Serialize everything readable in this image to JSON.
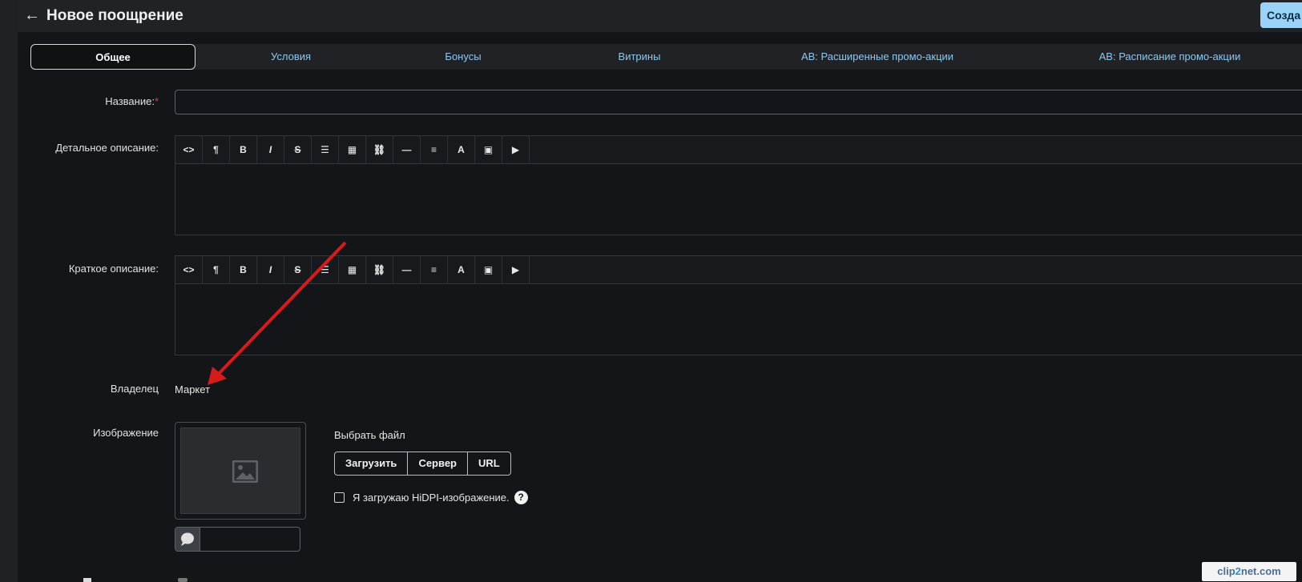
{
  "header": {
    "title": "Новое поощрение",
    "create_label": "Созда"
  },
  "tabs": [
    "Общее",
    "Условия",
    "Бонусы",
    "Витрины",
    "АВ: Расширенные промо-акции",
    "АВ: Расписание промо-акции"
  ],
  "form": {
    "name_label": "Название:",
    "required_mark": "*",
    "name_value": "",
    "detail_label": "Детальное описание:",
    "short_label": "Краткое описание:",
    "owner_label": "Владелец",
    "owner_value": "Маркет",
    "image_label": "Изображение",
    "choose_file": "Выбрать файл",
    "upload_buttons": [
      "Загрузить",
      "Сервер",
      "URL"
    ],
    "hidpi_label": "Я загружаю HiDPI-изображение.",
    "help_mark": "?"
  },
  "toolbar_icons": [
    "code-icon",
    "paragraph-icon",
    "bold-icon",
    "italic-icon",
    "strikethrough-icon",
    "list-icon",
    "table-icon",
    "link-icon",
    "horizontal-rule-icon",
    "align-icon",
    "font-color-icon",
    "image-icon",
    "video-icon"
  ],
  "toolbar_glyphs": [
    "<>",
    "¶",
    "B",
    "I",
    "S",
    "☰",
    "▦",
    "⛓",
    "—",
    "≡",
    "A",
    "▣",
    "▶"
  ],
  "annotation": {
    "arrow_color": "#d91a1a"
  },
  "watermark": {
    "left": "clip",
    "mid": "2",
    "right": "net.com"
  }
}
